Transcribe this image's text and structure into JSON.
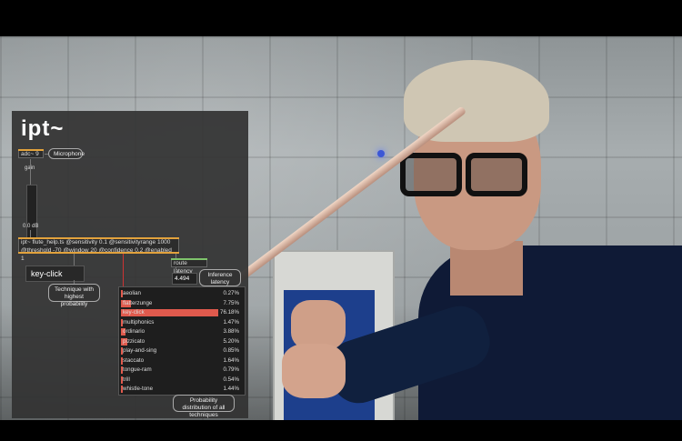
{
  "logo": "ipt~",
  "adc": {
    "label": "adc~ 9",
    "annotation": "Microphone"
  },
  "gain": {
    "label": "gain",
    "value": "0.0 dB"
  },
  "ipt_object": {
    "line1": "ipt~ flute_help.ts @sensitivity 0.1 @sensitivityrange 1000",
    "line2": "@threshold -70 @window 20 @confidence 0.2 @enabled 1"
  },
  "technique": {
    "value": "key-click",
    "annotation": "Technique with highest probability"
  },
  "latency": {
    "route_label": "route latency",
    "value": "4.494",
    "annotation": "Inference latency (ms)"
  },
  "distribution": {
    "annotation": "Probability distribution of all techniques",
    "rows": [
      {
        "name": "aeolian",
        "pct": "0.27%",
        "frac": 0.0027
      },
      {
        "name": "flatterzunge",
        "pct": "7.75%",
        "frac": 0.0775
      },
      {
        "name": "key-click",
        "pct": "76.18%",
        "frac": 0.7618
      },
      {
        "name": "multiphonics",
        "pct": "1.47%",
        "frac": 0.0147
      },
      {
        "name": "ordinario",
        "pct": "3.88%",
        "frac": 0.0388
      },
      {
        "name": "pizzicato",
        "pct": "5.20%",
        "frac": 0.052
      },
      {
        "name": "play-and-sing",
        "pct": "0.85%",
        "frac": 0.0085
      },
      {
        "name": "staccato",
        "pct": "1.64%",
        "frac": 0.0164
      },
      {
        "name": "tongue-ram",
        "pct": "0.79%",
        "frac": 0.0079
      },
      {
        "name": "trill",
        "pct": "0.54%",
        "frac": 0.0054
      },
      {
        "name": "whistle-tone",
        "pct": "1.44%",
        "frac": 0.0144
      }
    ]
  },
  "colors": {
    "accent": "#e2a23c",
    "bar": "#e05a4d",
    "route": "#7ec46b"
  }
}
